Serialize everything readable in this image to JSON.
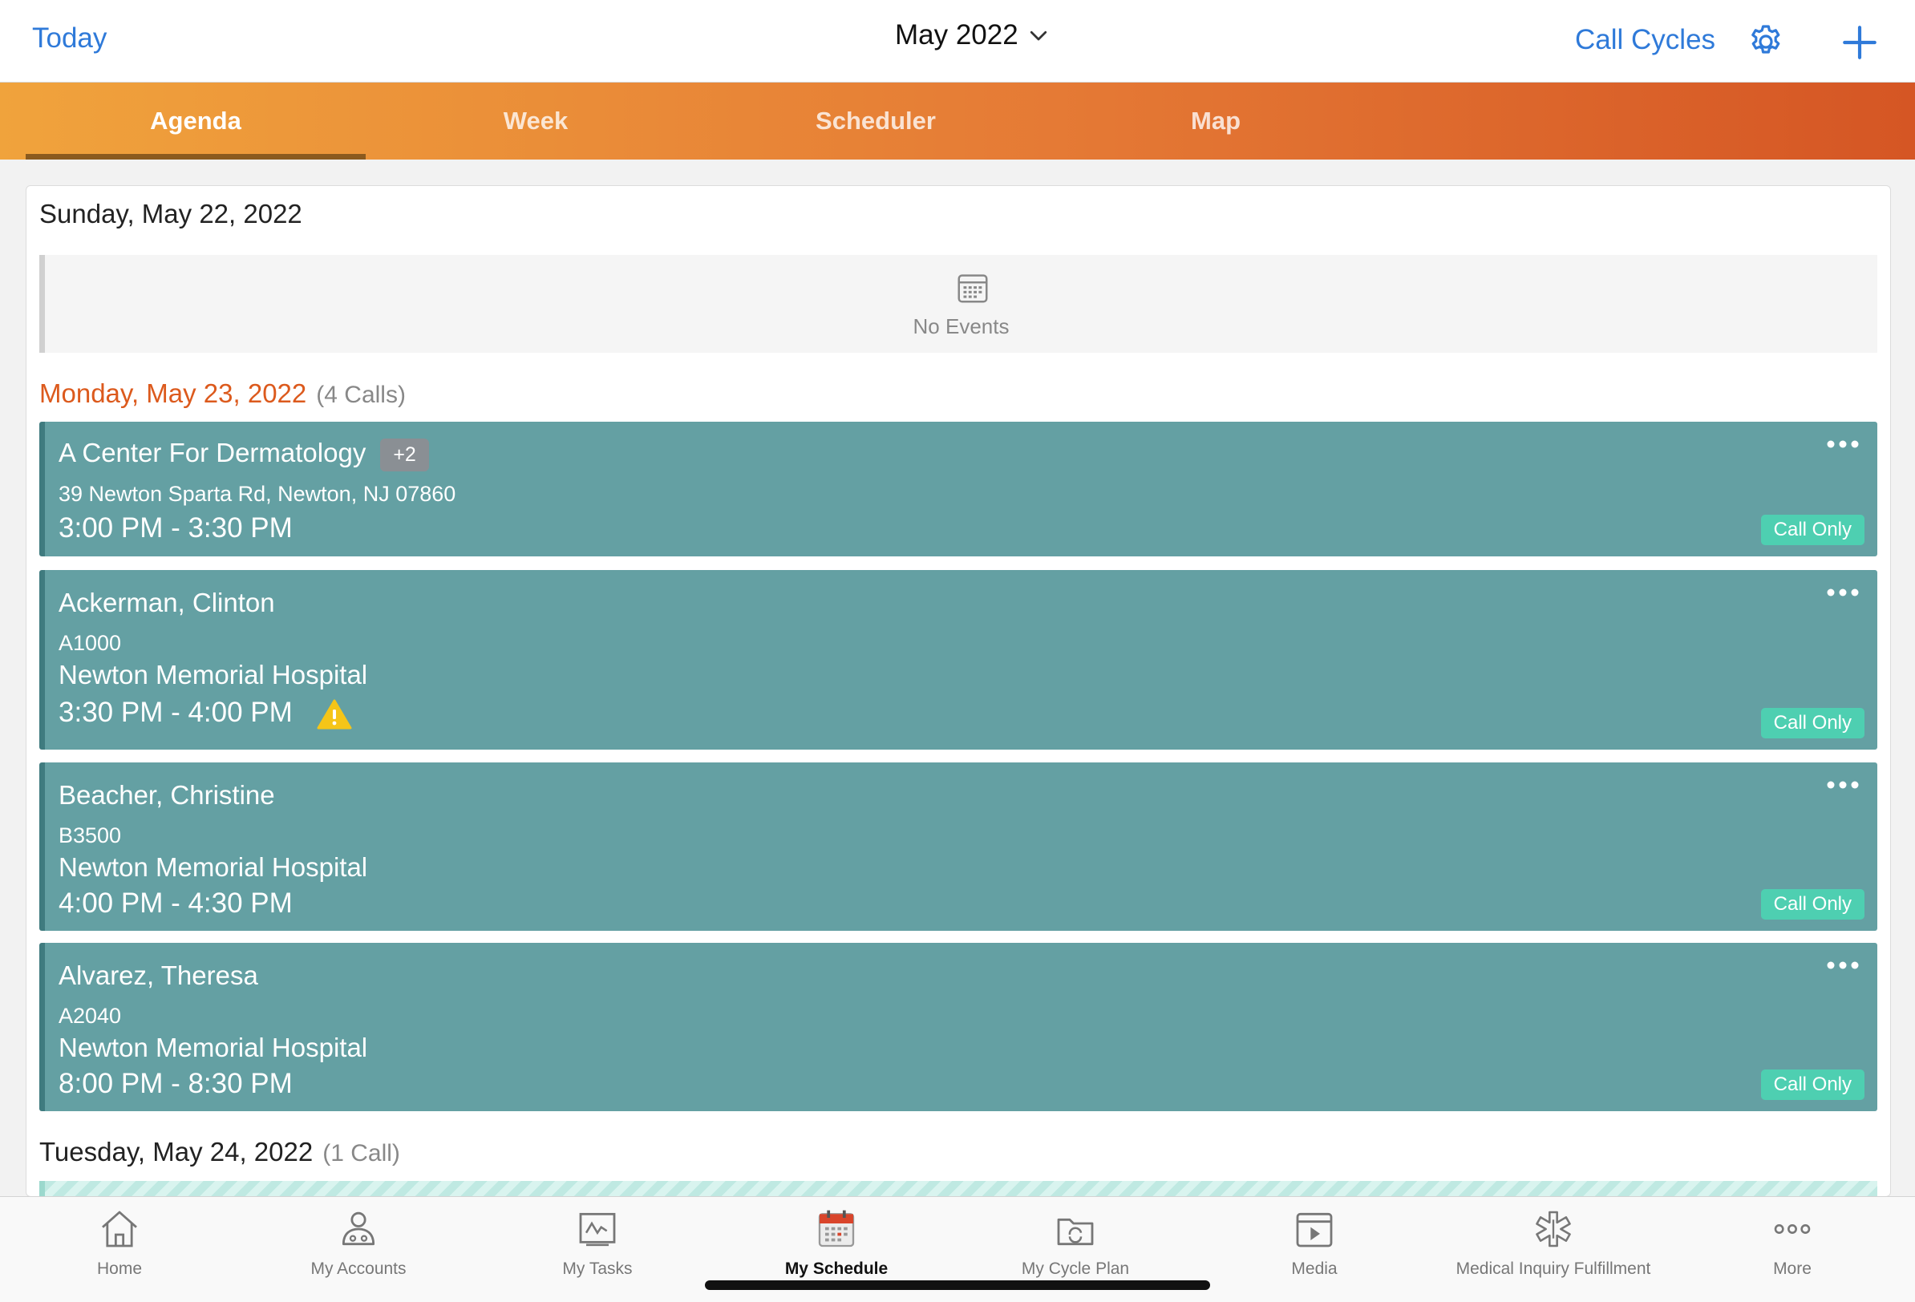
{
  "header": {
    "today_label": "Today",
    "month_label": "May 2022",
    "call_cycles_label": "Call Cycles"
  },
  "tabs": [
    {
      "label": "Agenda",
      "active": true
    },
    {
      "label": "Week",
      "active": false
    },
    {
      "label": "Scheduler",
      "active": false
    },
    {
      "label": "Map",
      "active": false
    }
  ],
  "days": [
    {
      "date": "Sunday, May 22, 2022",
      "count": "",
      "empty_label": "No Events"
    },
    {
      "date": "Monday, May 23, 2022",
      "count": "(4 Calls)"
    },
    {
      "date": "Tuesday, May 24, 2022",
      "count": "(1 Call)"
    }
  ],
  "calls": [
    {
      "name": "A Center For Dermatology",
      "badge": "+2",
      "address": "39 Newton Sparta Rd, Newton, NJ 07860",
      "time": "3:00 PM - 3:30 PM",
      "status": "Call Only"
    },
    {
      "name": "Ackerman, Clinton",
      "id": "A1000",
      "org": "Newton Memorial Hospital",
      "time": "3:30 PM - 4:00 PM",
      "warning": true,
      "status": "Call Only"
    },
    {
      "name": "Beacher, Christine",
      "id": "B3500",
      "org": "Newton Memorial Hospital",
      "time": "4:00 PM - 4:30 PM",
      "status": "Call Only"
    },
    {
      "name": "Alvarez, Theresa",
      "id": "A2040",
      "org": "Newton Memorial Hospital",
      "time": "8:00 PM - 8:30 PM",
      "status": "Call Only"
    }
  ],
  "bottom_nav": [
    {
      "label": "Home",
      "icon": "home-icon"
    },
    {
      "label": "My Accounts",
      "icon": "accounts-icon"
    },
    {
      "label": "My Tasks",
      "icon": "tasks-icon"
    },
    {
      "label": "My Schedule",
      "icon": "calendar-icon",
      "active": true
    },
    {
      "label": "My Cycle Plan",
      "icon": "cycle-plan-icon"
    },
    {
      "label": "Media",
      "icon": "media-icon"
    },
    {
      "label": "Medical Inquiry Fulfillment",
      "icon": "medical-icon"
    },
    {
      "label": "More",
      "icon": "more-icon"
    }
  ],
  "colors": {
    "accent_blue": "#2f7ad9",
    "tab_orange_start": "#f0a33c",
    "tab_orange_end": "#d55624",
    "card_teal": "#64a0a3",
    "status_green": "#4ecfb1",
    "today_orange": "#dc5a1d"
  }
}
